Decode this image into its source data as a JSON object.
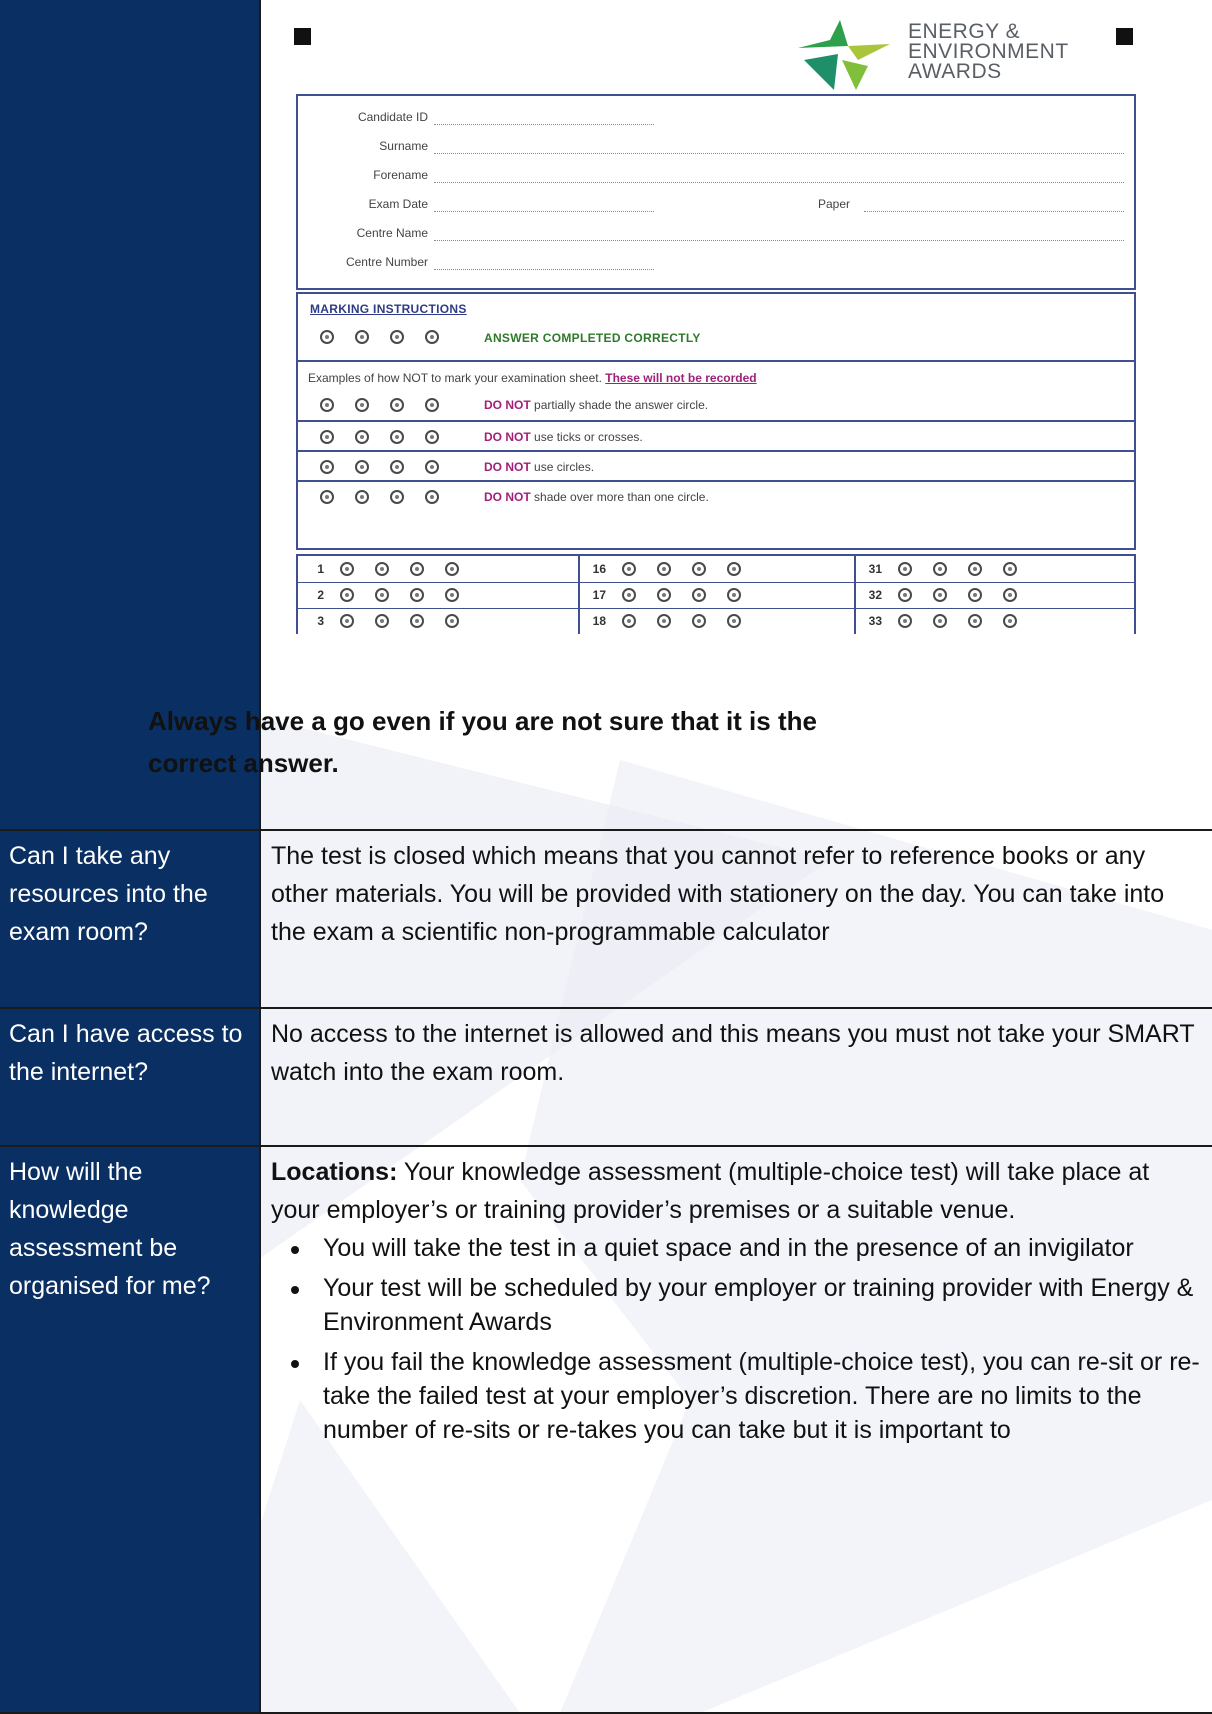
{
  "answer_sheet": {
    "logo_lines": [
      "ENERGY &",
      "ENVIRONMENT",
      "AWARDS"
    ],
    "candidate_fields": [
      {
        "label": "Candidate ID"
      },
      {
        "label": "Surname"
      },
      {
        "label": "Forename"
      },
      {
        "label": "Exam Date",
        "second_label": "Paper"
      },
      {
        "label": "Centre Name"
      },
      {
        "label": "Centre Number"
      }
    ],
    "marking_heading": "MARKING INSTRUCTIONS",
    "correct_example": "ANSWER COMPLETED CORRECTLY",
    "not_examples_intro": "Examples of how NOT to mark your examination sheet.",
    "not_recorded": "These will not be recorded",
    "do_not_keyword": "DO NOT",
    "do_not_items": [
      "partially shade the answer circle.",
      "use ticks or crosses.",
      "use circles.",
      "shade over more than one circle."
    ],
    "grid_numbers": [
      [
        "1",
        "2",
        "3"
      ],
      [
        "16",
        "17",
        "18"
      ],
      [
        "31",
        "32",
        "33"
      ]
    ]
  },
  "tip": "Always have a go even if you are not sure that it is the correct answer.",
  "rows": [
    {
      "question": "Can I take any resources into the exam room?",
      "answer": "The test is closed which means that you cannot refer to reference books or any other materials. You will be provided with stationery on the day. You can take into the exam a scientific non-programmable calculator"
    },
    {
      "question": "Can I have access to the internet?",
      "answer": "No access to the internet is allowed and this means you must not take your SMART watch into the exam room."
    },
    {
      "question": "How will the knowledge assessment be organised for me?",
      "answer_lead": "Locations:",
      "answer": " Your knowledge assessment (multiple-choice test) will take place at your employer’s or training provider’s premises or a suitable venue.",
      "bullets": [
        "You will take the test in a quiet space and in the presence of an invigilator",
        "Your test will be scheduled by your employer or training provider with Energy & Environment Awards",
        "If you fail the knowledge assessment (multiple-choice test), you can re-sit or re-take the failed test at your employer’s discretion. There are no limits to the number of re-sits or re-takes you can take but it is important to"
      ]
    }
  ]
}
